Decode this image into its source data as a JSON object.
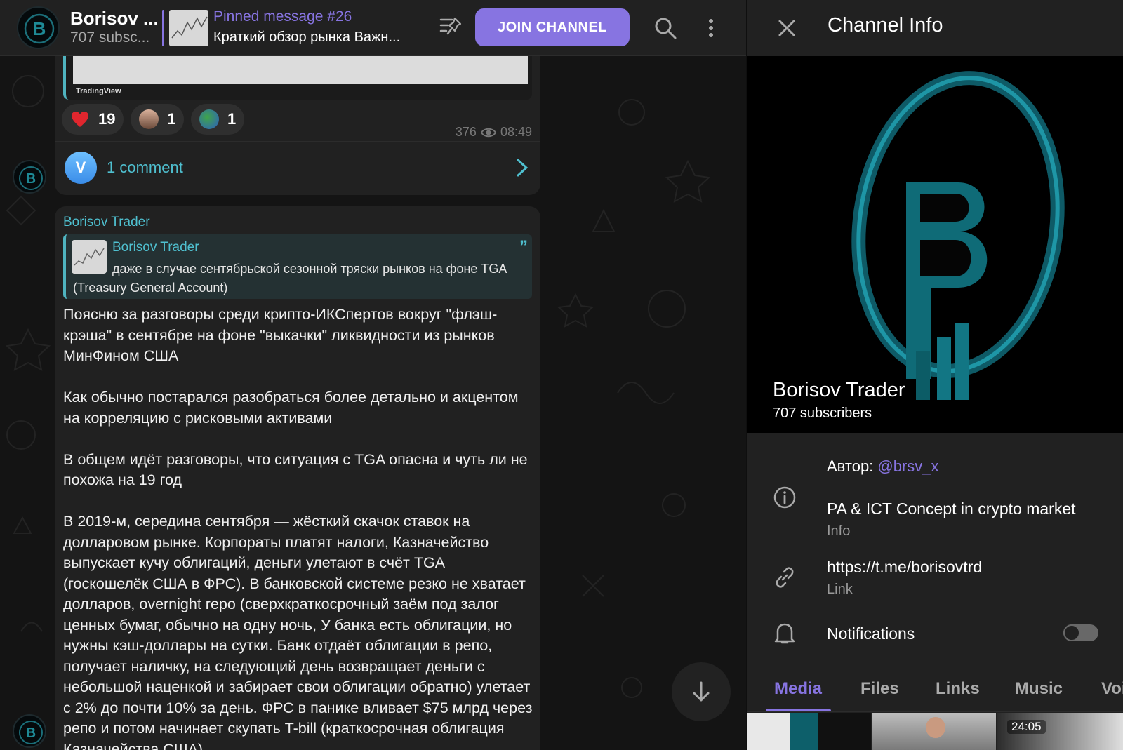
{
  "chat": {
    "header": {
      "title": "Borisov ...",
      "subscribers": "707 subsc...",
      "pinned_title": "Pinned message #26",
      "pinned_text": "Краткий обзор рынка Важн...",
      "join_label": "JOIN CHANNEL"
    },
    "message1": {
      "chart_watermark": "TradingView",
      "reactions": [
        {
          "icon": "heart-icon",
          "count": "19"
        },
        {
          "icon": "person-sticker-icon",
          "count": "1"
        },
        {
          "icon": "globe-sticker-icon",
          "count": "1"
        }
      ],
      "views": "376",
      "time": "08:49",
      "comment_avatar_letter": "V",
      "comments_label": "1 comment"
    },
    "message2": {
      "author": "Borisov Trader",
      "quote_author": "Borisov Trader",
      "quote_text": "даже в случае сентябрьской сезонной тряски рынков на фоне TGA (Treasury General Account)",
      "paragraphs": [
        "Поясню за разговоры среди крипто-ИКСпертов вокруг \"флэш-крэша\" в сентябре на фоне \"выкачки\" ликвидности из рынков МинФином США",
        "Как обычно постарался разобраться более детально и акцентом на корреляцию с рисковыми активами",
        "В общем идёт разговоры, что ситуация с TGA опасна и чуть ли не похожа на 19 год",
        "В 2019-м, середина сентября — жёсткий скачок ставок на долларовом рынке. Корпораты платят налоги, Казначейство выпускает кучу облигаций, деньги улетают в счёт TGA (госкошелёк США в ФРС). В банковской системе резко не хватает долларов, overnight repo (сверхкраткосрочный заём под залог ценных бумаг, обычно на одну ночь, У банка есть облигации, но нужны кэш-доллары на сутки. Банк отдаёт облигации в репо, получает наличку, на следующий день возвращает деньги с небольшой наценкой и забирает свои облигации обратно) улетает с 2% до почти 10% за день. ФРС в панике вливает $75 млрд через репо и потом начинает скупать T-bill (краткосрочная облигация Казначейства США)"
      ]
    }
  },
  "info": {
    "title": "Channel Info",
    "name": "Borisov Trader",
    "subscribers": "707 subscribers",
    "author_prefix": "Автор: ",
    "author_handle": "@brsv_x",
    "description": "PA & ICT Concept in crypto market",
    "description_label": "Info",
    "link": "https://t.me/borisovtrd",
    "link_label": "Link",
    "notifications_label": "Notifications",
    "notifications_on": false,
    "tabs": [
      "Media",
      "Files",
      "Links",
      "Music",
      "Voi"
    ],
    "active_tab": "Media",
    "media_duration": "24:05"
  },
  "colors": {
    "accent": "#8774e1",
    "teal": "#4fc0d0",
    "bubble": "#212121",
    "background": "#141414"
  }
}
